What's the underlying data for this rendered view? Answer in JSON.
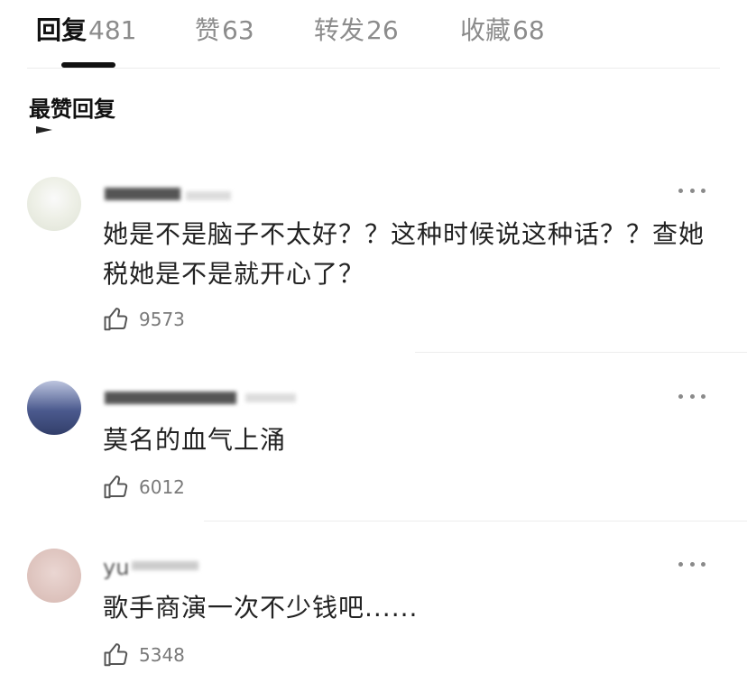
{
  "tabs": [
    {
      "label": "回复",
      "count": "481",
      "active": true
    },
    {
      "label": "赞",
      "count": "63",
      "active": false
    },
    {
      "label": "转发",
      "count": "26",
      "active": false
    },
    {
      "label": "收藏",
      "count": "68",
      "active": false
    }
  ],
  "section": {
    "title": "最赞回复"
  },
  "comments": [
    {
      "text": "她是不是脑子不太好？？这种时候说这种话？？查她税她是不是就开心了？",
      "likes": "9573"
    },
    {
      "text": "莫名的血气上涌",
      "likes": "6012"
    },
    {
      "username_visible": "yu",
      "text": "歌手商演一次不少钱吧......",
      "likes": "5348"
    }
  ],
  "icons": {
    "like": "thumbs-up-icon",
    "more": "more-dots-icon"
  },
  "colors": {
    "text_primary": "#111111",
    "text_secondary": "#8c8c8c",
    "active_underline": "#111111"
  }
}
